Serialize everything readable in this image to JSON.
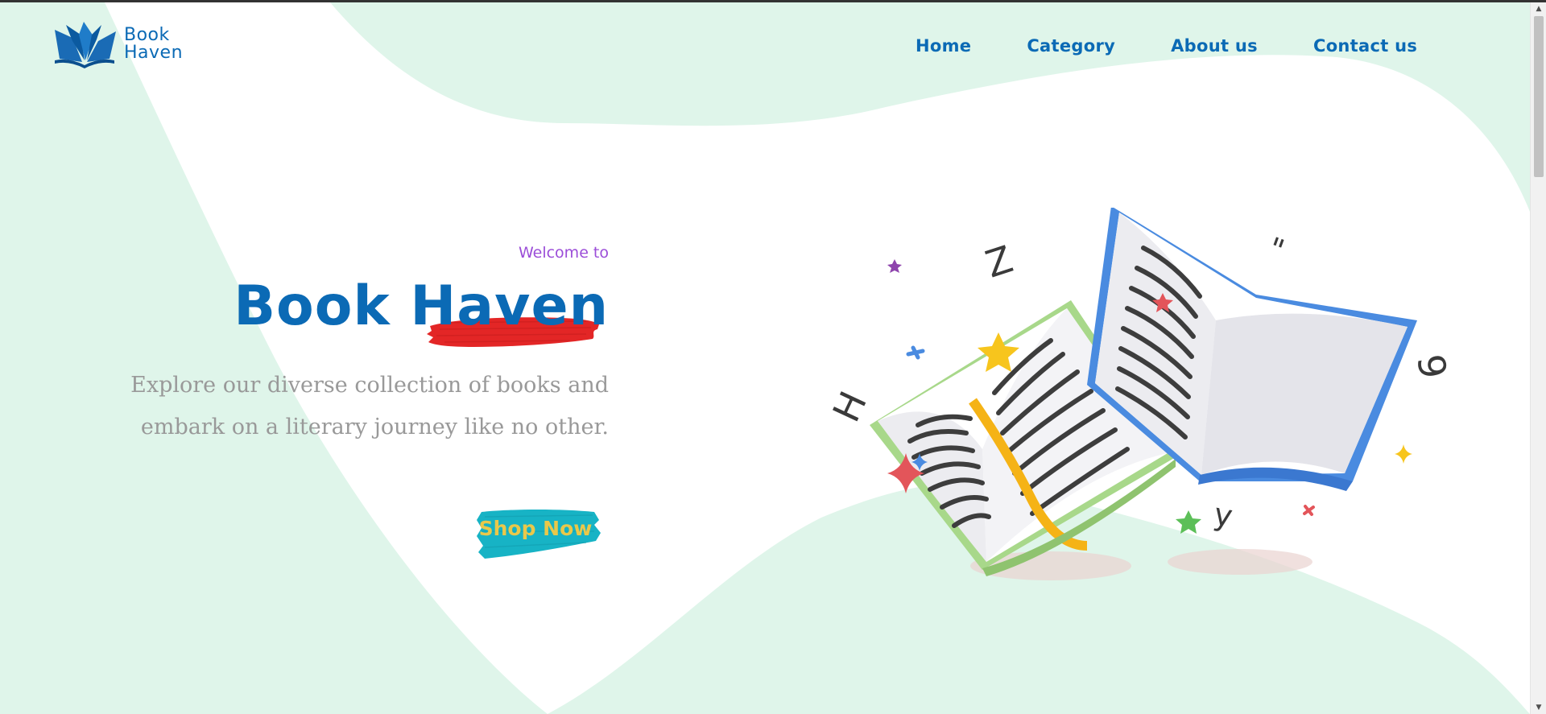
{
  "brand": {
    "name_line1": "Book",
    "name_line2": "Haven",
    "logo_icon": "open-book-icon"
  },
  "nav": {
    "items": [
      {
        "label": "Home"
      },
      {
        "label": "Category"
      },
      {
        "label": "About us"
      },
      {
        "label": "Contact us"
      }
    ]
  },
  "hero": {
    "welcome": "Welcome to",
    "title": "Book Haven",
    "description": "Explore our diverse collection of books and embark on a literary journey like no other.",
    "cta": "Shop Now"
  },
  "illustration": {
    "letters": [
      "Z",
      "H",
      "y",
      "6",
      "\""
    ],
    "icons": [
      "open-book-icon",
      "star-icon",
      "sparkle-icon"
    ]
  },
  "colors": {
    "brand": "#0b6ab5",
    "accent_purple": "#9b4dd8",
    "mint_background": "#dff5ea",
    "brush_red": "#e32626",
    "brush_teal": "#17b3c5",
    "cta_text": "#e9c84a",
    "text_gray": "#999999"
  }
}
